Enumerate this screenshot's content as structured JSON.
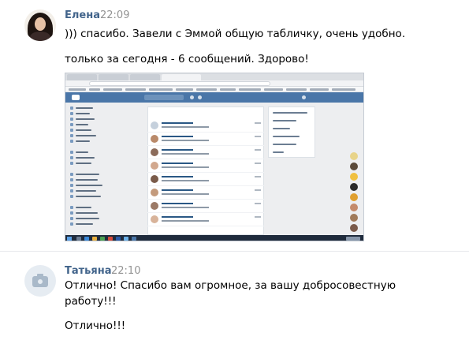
{
  "messages": [
    {
      "author": "Елена",
      "time": "22:09",
      "lines": [
        "))) спасибо. Завели с Эммой общую табличку, очень удобно.",
        "",
        "только за сегодня - 6 сообщений. Здорово!"
      ]
    },
    {
      "author": "Татьяна",
      "time": "22:10",
      "lines": [
        "Отлично! Спасибо вам огромное, за вашу добросовестную",
        "работу!!!",
        "",
        "Отлично!!!"
      ]
    }
  ],
  "attachment": {
    "kind": "screenshot",
    "colors": {
      "header": "#4a76a8",
      "page_bg": "#edeef0",
      "taskbar": "#1f2b3c"
    }
  },
  "icons": {
    "elena_avatar": "user-photo",
    "tatyana_avatar": "camera-icon"
  },
  "colors": {
    "author_name": "#42648b",
    "time": "#939393",
    "text": "#000000"
  }
}
